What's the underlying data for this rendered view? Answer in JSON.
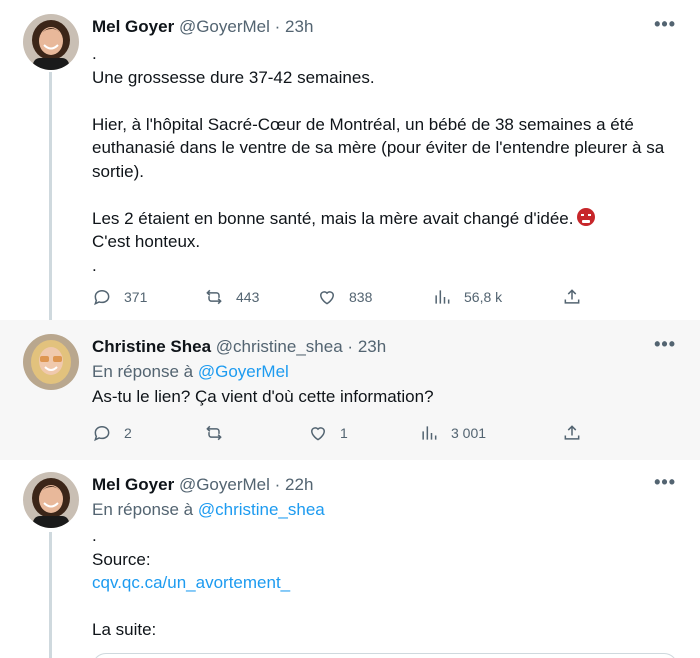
{
  "tweets": [
    {
      "author_name": "Mel Goyer",
      "handle": "@GoyerMel",
      "time": "23h",
      "text": ".\nUne grossesse dure 37-42 semaines.\n\nHier, à l'hôpital Sacré-Cœur de Montréal, un bébé de 38 semaines a été euthanasié dans le ventre de sa mère (pour éviter de l'entendre pleurer à sa sortie).\n\nLes 2 étaient en bonne santé, mais la mère avait changé d'idée.",
      "text_tail": "C'est honteux.\n.",
      "emoji": "enraged-face-emoji",
      "replies": "371",
      "retweets": "443",
      "likes": "838",
      "views": "56,8 k"
    },
    {
      "author_name": "Christine Shea",
      "handle": "@christine_shea",
      "time": "23h",
      "reply_prefix": "En réponse à",
      "reply_to": "@GoyerMel",
      "text": "As-tu le lien? Ça vient d'où cette information?",
      "replies": "2",
      "retweets": "",
      "likes": "1",
      "views": "3 001"
    },
    {
      "author_name": "Mel Goyer",
      "handle": "@GoyerMel",
      "time": "22h",
      "reply_prefix": "En réponse à",
      "reply_to": "@christine_shea",
      "text_lead": ".\nSource:",
      "link": "cqv.qc.ca/un_avortement_",
      "text_end": "La suite:"
    }
  ],
  "separator": "·",
  "more_label": "•••",
  "icons": [
    "reply-icon",
    "retweet-icon",
    "like-icon",
    "views-icon",
    "share-icon",
    "more-icon"
  ],
  "colors": {
    "link": "#1d9bf0",
    "muted": "#536471",
    "highlight_bg": "#f7f7f7"
  }
}
